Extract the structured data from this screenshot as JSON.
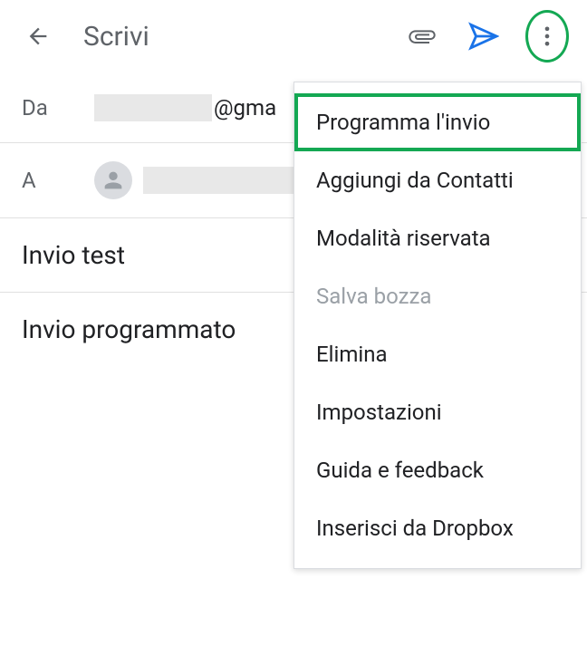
{
  "header": {
    "title": "Scrivi"
  },
  "fields": {
    "from_label": "Da",
    "from_suffix": "@gma",
    "to_label": "A"
  },
  "subject": "Invio test",
  "body": "Invio programmato",
  "menu": {
    "items": [
      {
        "label": "Programma l'invio",
        "highlighted": true,
        "disabled": false
      },
      {
        "label": "Aggiungi da Contatti",
        "highlighted": false,
        "disabled": false
      },
      {
        "label": "Modalità riservata",
        "highlighted": false,
        "disabled": false
      },
      {
        "label": "Salva bozza",
        "highlighted": false,
        "disabled": true
      },
      {
        "label": "Elimina",
        "highlighted": false,
        "disabled": false
      },
      {
        "label": "Impostazioni",
        "highlighted": false,
        "disabled": false
      },
      {
        "label": "Guida e feedback",
        "highlighted": false,
        "disabled": false
      },
      {
        "label": "Inserisci da Dropbox",
        "highlighted": false,
        "disabled": false
      }
    ]
  }
}
